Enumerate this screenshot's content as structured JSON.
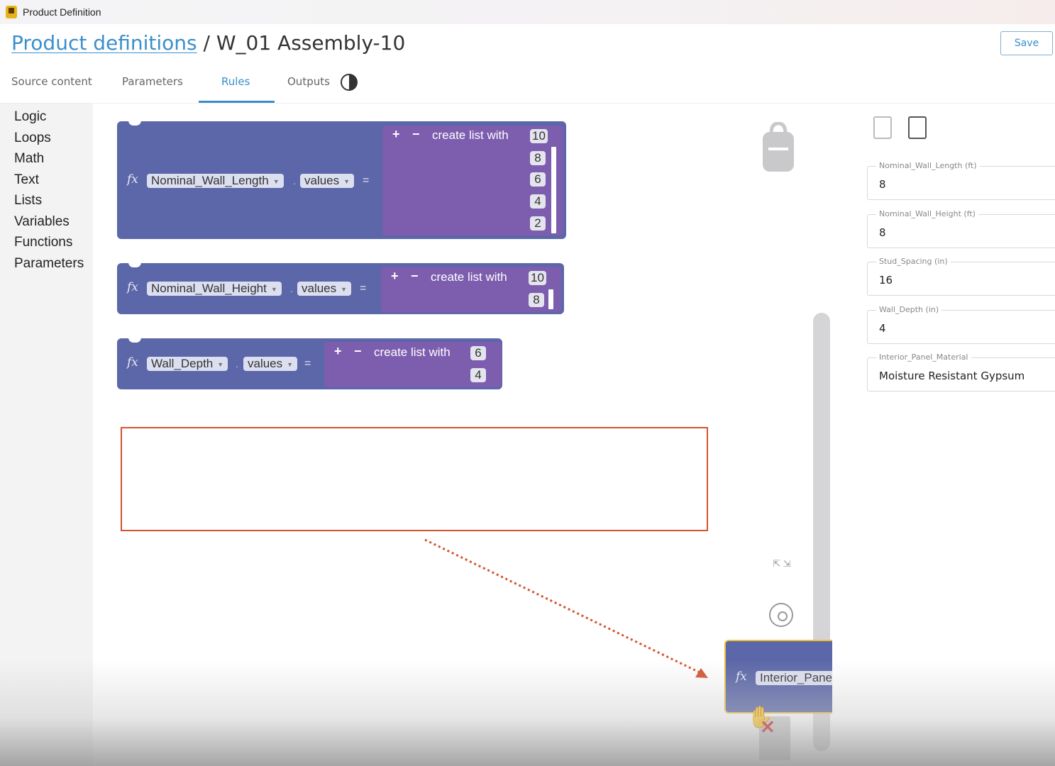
{
  "window": {
    "title": "Product Definition"
  },
  "header": {
    "breadcrumb_link": "Product definitions",
    "breadcrumb_separator": " / ",
    "breadcrumb_current": "W_01 Assembly-10",
    "save_label": "Save"
  },
  "tabs": [
    {
      "label": "Source content"
    },
    {
      "label": "Parameters"
    },
    {
      "label": "Rules",
      "active": true
    },
    {
      "label": "Outputs"
    }
  ],
  "sidebar": {
    "categories": [
      "Logic",
      "Loops",
      "Math",
      "Text",
      "Lists",
      "Variables",
      "Functions",
      "Parameters"
    ]
  },
  "blocks": [
    {
      "fx": "fx",
      "param": "Nominal_Wall_Length",
      "field": "values",
      "op": "=",
      "list_label": "create list with",
      "plus": "+",
      "minus": "−",
      "items": [
        "10",
        "8",
        "6",
        "4",
        "2"
      ]
    },
    {
      "fx": "fx",
      "param": "Nominal_Wall_Height",
      "field": "values",
      "op": "=",
      "list_label": "create list with",
      "plus": "+",
      "minus": "−",
      "items": [
        "10",
        "8"
      ]
    },
    {
      "fx": "fx",
      "param": "Wall_Depth",
      "field": "values",
      "op": "=",
      "list_label": "create list with",
      "plus": "+",
      "minus": "−",
      "items": [
        "6",
        "4"
      ]
    }
  ],
  "drag_block": {
    "fx": "fx",
    "param": "Interior_Pane"
  },
  "workspace_icons": {
    "backpack": "backpack-icon",
    "fit": "fit-to-screen-icon",
    "fit_glyphs": "⇱ ⇲",
    "recenter": "crosshair-icon",
    "trash": "trash-icon",
    "cursor": "grab-hand-icon",
    "cursor_glyph": "✋",
    "delete": "close-icon",
    "delete_glyph": "✕"
  },
  "right_panel": {
    "fields": [
      {
        "label": "Nominal_Wall_Length (ft)",
        "value": "8"
      },
      {
        "label": "Nominal_Wall_Height (ft)",
        "value": "8"
      },
      {
        "label": "Stud_Spacing (in)",
        "value": "16"
      },
      {
        "label": "Wall_Depth (in)",
        "value": "4"
      },
      {
        "label": "Interior_Panel_Material",
        "value": "Moisture Resistant Gypsum"
      }
    ]
  },
  "colors": {
    "accent": "#3a8fcb",
    "block": "#5b67a8",
    "list_block": "#7c5dae",
    "highlight": "#d4532f"
  }
}
